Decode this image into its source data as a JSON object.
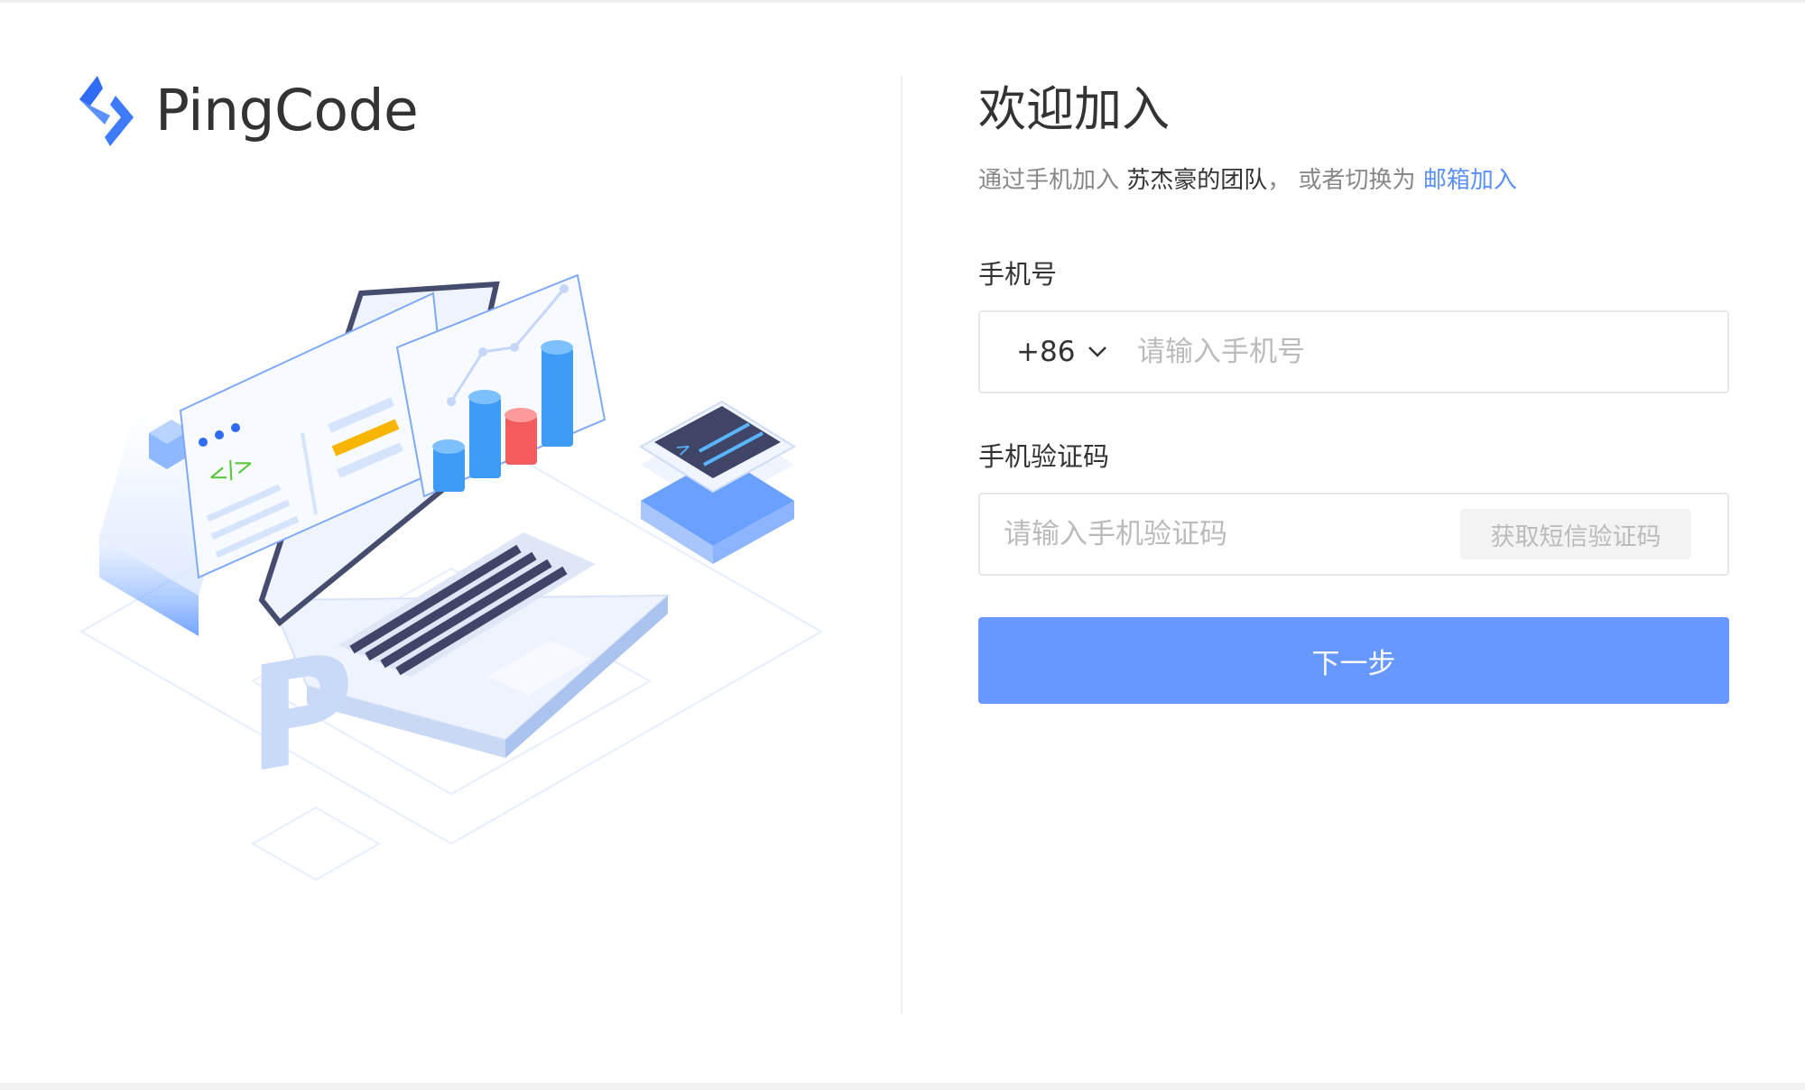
{
  "brand": {
    "name": "PingCode",
    "color": "#3d7bfa"
  },
  "illustration": {
    "icon": "laptop-dashboard-illustration",
    "code_tag": "</>",
    "terminal_prompt": ">",
    "letter": "P"
  },
  "form": {
    "title": "欢迎加入",
    "subtitle_prefix": "通过手机加入",
    "team_name": "苏杰豪的团队",
    "subtitle_mid": "， 或者切换为",
    "switch_link": "邮箱加入",
    "phone_label": "手机号",
    "country_code": "+86",
    "phone_placeholder": "请输入手机号",
    "code_label": "手机验证码",
    "code_placeholder": "请输入手机验证码",
    "sms_button": "获取短信验证码",
    "next_button": "下一步"
  },
  "colors": {
    "primary": "#6698ff",
    "link": "#5b8ff9",
    "bar_red": "#f25c5c",
    "bar_blue": "#3d9bf5",
    "highlight_yellow": "#f7b500",
    "code_green": "#5cc63c"
  }
}
